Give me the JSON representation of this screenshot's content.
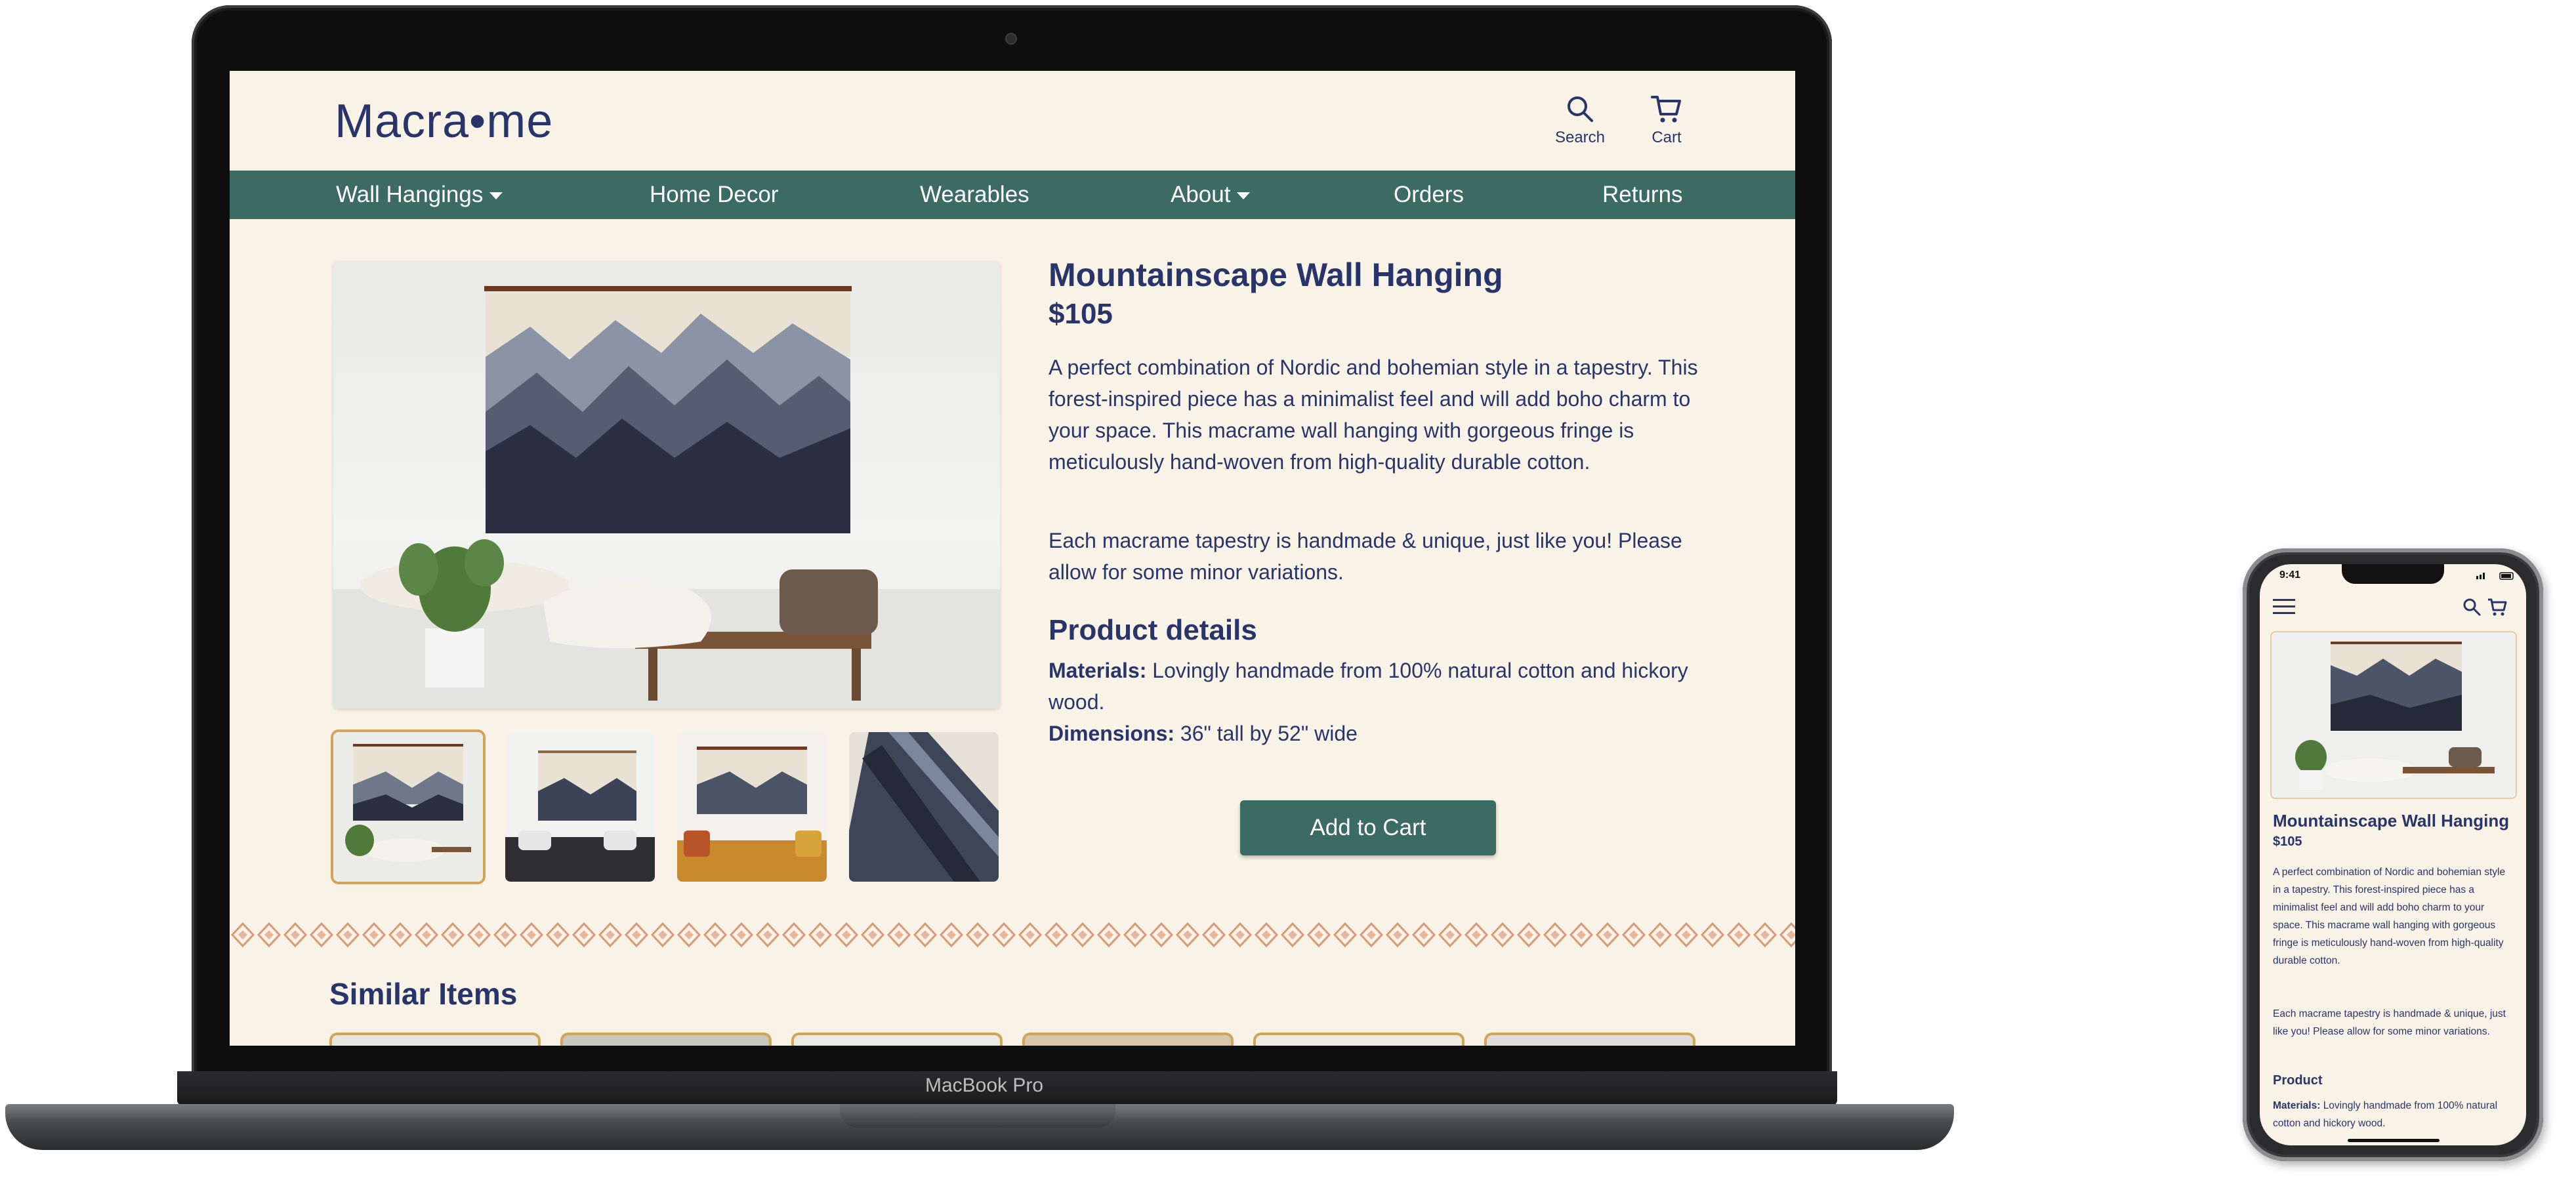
{
  "laptop": {
    "model_label": "MacBook Pro"
  },
  "site": {
    "logo": "Macra•me",
    "header": {
      "search_label": "Search",
      "cart_label": "Cart"
    },
    "nav": [
      {
        "label": "Wall Hangings",
        "has_dropdown": true
      },
      {
        "label": "Home Decor",
        "has_dropdown": false
      },
      {
        "label": "Wearables",
        "has_dropdown": false
      },
      {
        "label": "About",
        "has_dropdown": true
      },
      {
        "label": "Orders",
        "has_dropdown": false
      },
      {
        "label": "Returns",
        "has_dropdown": false
      }
    ],
    "product": {
      "title": "Mountainscape Wall Hanging",
      "price": "$105",
      "description": "A perfect combination of Nordic and bohemian style in a tapestry. This forest-inspired piece has a minimalist feel and will add boho charm to your space. This macrame wall hanging with gorgeous fringe is meticulously hand-woven from high-quality durable cotton.",
      "note": "Each macrame tapestry is handmade &  unique, just like you! Please allow for some minor variations.",
      "details_heading": "Product details",
      "materials_label": "Materials:",
      "materials_value": "Lovingly handmade from 100% natural cotton and hickory wood.",
      "dimensions_label": "Dimensions:",
      "dimensions_value": "36\" tall by 52\" wide",
      "add_to_cart_label": "Add to Cart",
      "selected_thumbnail": 1,
      "thumbnail_count": 4
    },
    "similar_heading": "Similar Items"
  },
  "phone": {
    "time": "9:41",
    "title": "Mountainscape Wall Hanging",
    "price": "$105",
    "description": "A perfect combination of Nordic and bohemian style in a tapestry. This forest-inspired piece has a minimalist feel and will add boho charm to your space. This macrame wall hanging with gorgeous fringe is meticulously hand-woven from high-quality durable cotton.",
    "note": "Each macrame tapestry is handmade & unique, just like you! Please allow for some minor variations.",
    "details_heading": "Product",
    "materials_label": "Materials:",
    "materials_value": "Lovingly handmade from 100% natural cotton and hickory wood."
  },
  "colors": {
    "background": "#f8f3e6",
    "navy": "#29356a",
    "teal": "#3b6b62",
    "gold": "#d4a356"
  },
  "icons": [
    "search-icon",
    "cart-icon",
    "caret-down-icon",
    "hamburger-icon"
  ]
}
